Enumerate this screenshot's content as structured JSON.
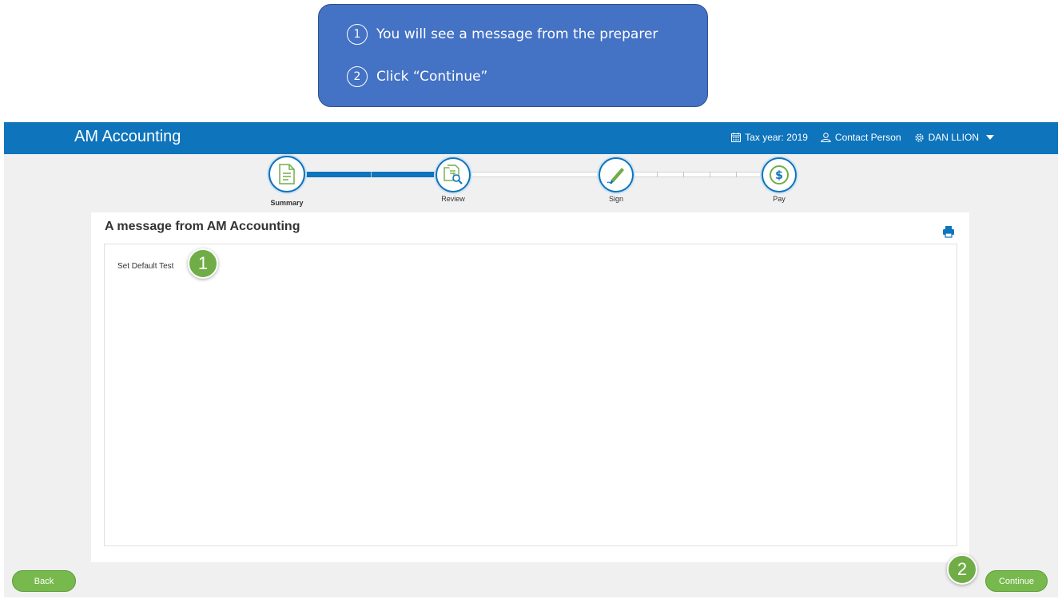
{
  "callout": {
    "steps": [
      {
        "num": "1",
        "text": "You will see a message from the preparer"
      },
      {
        "num": "2",
        "text": "Click “Continue”"
      }
    ]
  },
  "header": {
    "brand": "AM Accounting",
    "tax_year": "Tax year: 2019",
    "contact": "Contact Person",
    "user": "DAN LLION"
  },
  "stepper": {
    "steps": [
      {
        "label": "Summary",
        "icon": "document-icon",
        "active": true
      },
      {
        "label": "Review",
        "icon": "review-document-icon",
        "active": false
      },
      {
        "label": "Sign",
        "icon": "pen-icon",
        "active": false
      },
      {
        "label": "Pay",
        "icon": "dollar-icon",
        "active": false
      }
    ]
  },
  "panel": {
    "title": "A message from AM Accounting",
    "message": "Set Default Test"
  },
  "markers": {
    "one": "1",
    "two": "2"
  },
  "buttons": {
    "back": "Back",
    "continue": "Continue"
  },
  "colors": {
    "header": "#0e74bc",
    "callout": "#4472c4",
    "button": "#78b94e",
    "marker": "#70ad47"
  }
}
